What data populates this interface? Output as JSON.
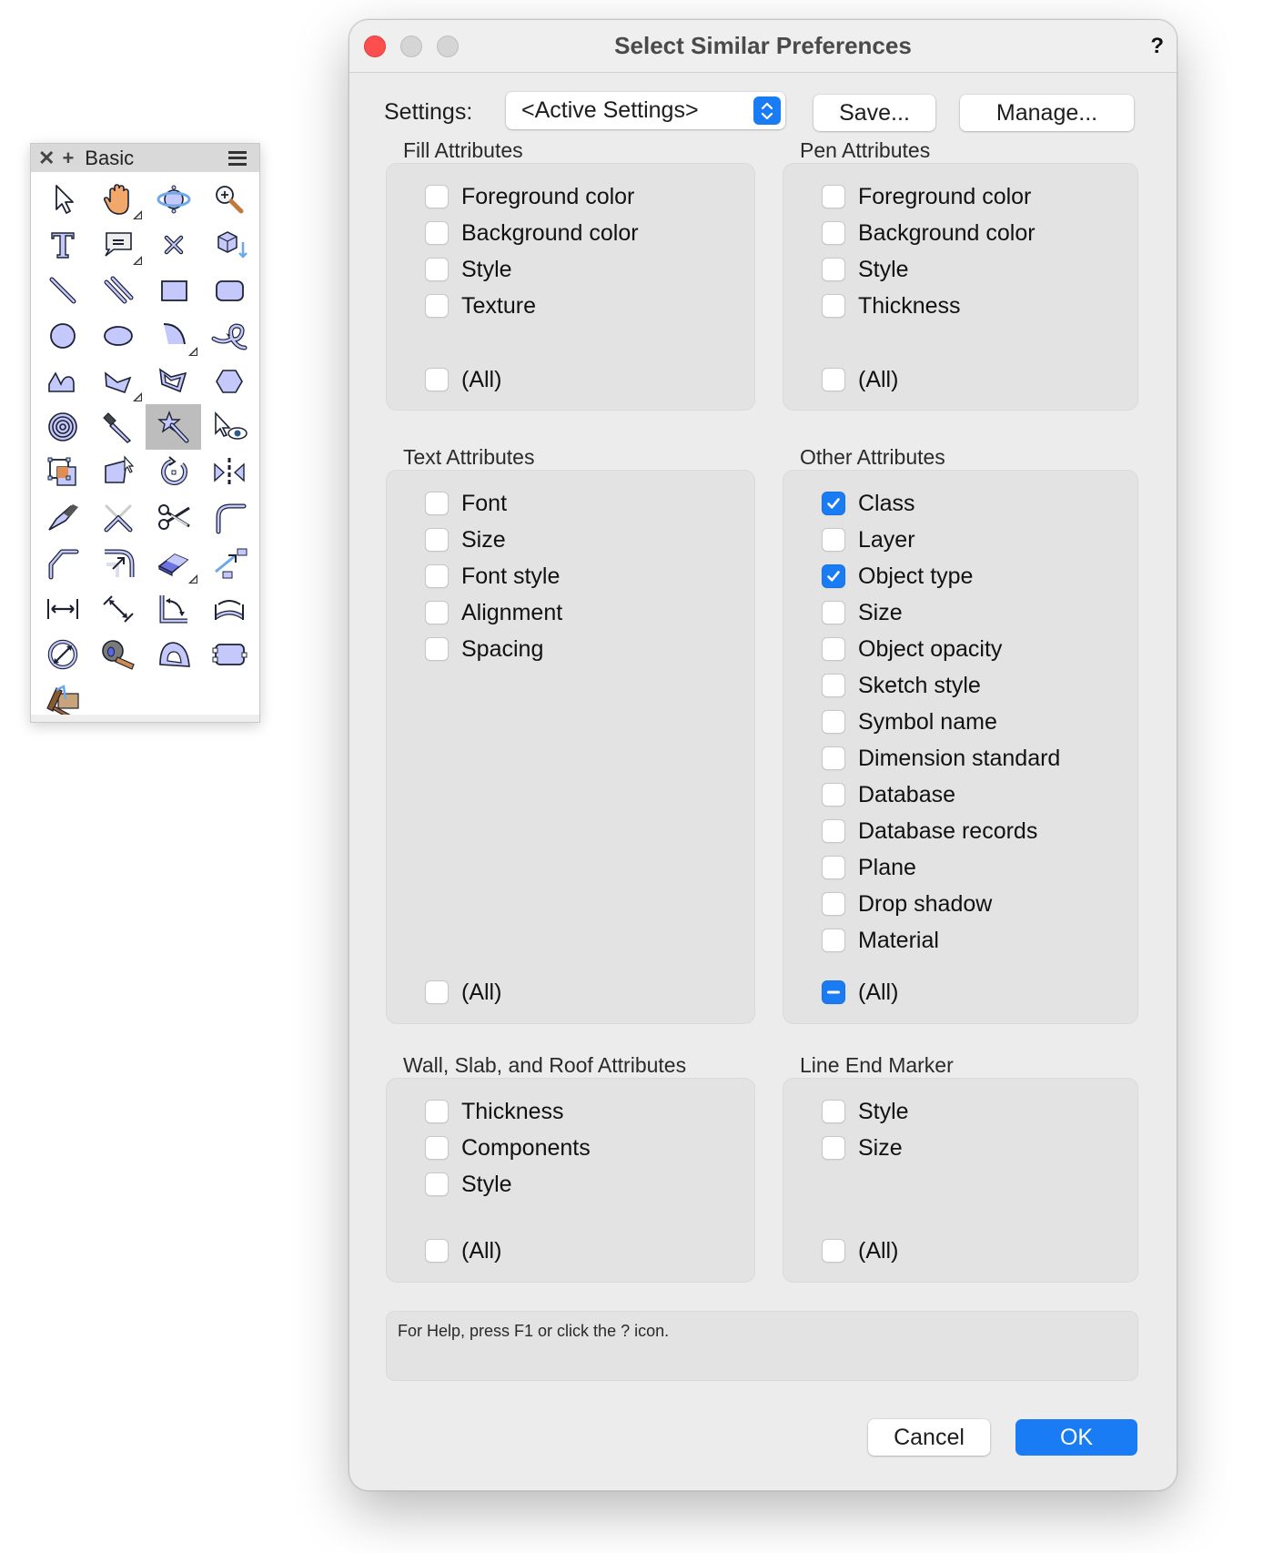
{
  "palette": {
    "title": "Basic",
    "close_glyph": "✕",
    "add_glyph": "+",
    "menu_icon": "hamburger-menu-icon",
    "tools": [
      {
        "name": "selection-tool",
        "has_submenu": false
      },
      {
        "name": "pan-tool",
        "has_submenu": true
      },
      {
        "name": "flyover-tool",
        "has_submenu": false
      },
      {
        "name": "zoom-tool",
        "has_submenu": false
      },
      {
        "name": "text-tool",
        "has_submenu": false
      },
      {
        "name": "callout-tool",
        "has_submenu": true
      },
      {
        "name": "locus-tool",
        "has_submenu": false
      },
      {
        "name": "3d-locus-tool",
        "has_submenu": false
      },
      {
        "name": "line-tool",
        "has_submenu": false
      },
      {
        "name": "double-line-tool",
        "has_submenu": false
      },
      {
        "name": "rectangle-tool",
        "has_submenu": false
      },
      {
        "name": "rounded-rectangle-tool",
        "has_submenu": false
      },
      {
        "name": "circle-tool",
        "has_submenu": false
      },
      {
        "name": "oval-tool",
        "has_submenu": false
      },
      {
        "name": "arc-tool",
        "has_submenu": true
      },
      {
        "name": "freehand-tool",
        "has_submenu": false
      },
      {
        "name": "polyline-tool",
        "has_submenu": false
      },
      {
        "name": "polygon-tool",
        "has_submenu": true
      },
      {
        "name": "double-line-polygon-tool",
        "has_submenu": false
      },
      {
        "name": "regular-polygon-tool",
        "has_submenu": false
      },
      {
        "name": "spiral-tool",
        "has_submenu": false
      },
      {
        "name": "eyedropper-tool",
        "has_submenu": false
      },
      {
        "name": "select-similar-tool",
        "has_submenu": false,
        "selected": true
      },
      {
        "name": "visibility-tool",
        "has_submenu": false
      },
      {
        "name": "reshape-tool",
        "has_submenu": false
      },
      {
        "name": "distort-tool",
        "has_submenu": false
      },
      {
        "name": "rotate-tool",
        "has_submenu": false
      },
      {
        "name": "mirror-tool",
        "has_submenu": false
      },
      {
        "name": "split-tool",
        "has_submenu": false
      },
      {
        "name": "trim-tool",
        "has_submenu": false
      },
      {
        "name": "scissors-tool",
        "has_submenu": false
      },
      {
        "name": "fillet-tool",
        "has_submenu": false
      },
      {
        "name": "chamfer-tool",
        "has_submenu": false
      },
      {
        "name": "offset-tool",
        "has_submenu": false
      },
      {
        "name": "eraser-tool",
        "has_submenu": true
      },
      {
        "name": "move-by-points-tool",
        "has_submenu": false
      },
      {
        "name": "dimension-tool",
        "has_submenu": false
      },
      {
        "name": "aligned-dimension-tool",
        "has_submenu": false
      },
      {
        "name": "angular-dimension-tool",
        "has_submenu": false
      },
      {
        "name": "arc-length-dimension-tool",
        "has_submenu": false
      },
      {
        "name": "radial-dimension-tool",
        "has_submenu": false
      },
      {
        "name": "tape-measure-tool",
        "has_submenu": false
      },
      {
        "name": "protractor-tool",
        "has_submenu": false
      },
      {
        "name": "data-tag-tool",
        "has_submenu": false
      },
      {
        "name": "attribute-mapping-tool",
        "has_submenu": false
      }
    ]
  },
  "dialog": {
    "title": "Select Similar Preferences",
    "help_label": "?",
    "settings": {
      "label": "Settings:",
      "selected": "<Active Settings>",
      "save_label": "Save...",
      "manage_label": "Manage..."
    },
    "groups": {
      "fill": {
        "title": "Fill Attributes",
        "items": [
          {
            "label": "Foreground color",
            "state": "unchecked"
          },
          {
            "label": "Background color",
            "state": "unchecked"
          },
          {
            "label": "Style",
            "state": "unchecked"
          },
          {
            "label": "Texture",
            "state": "unchecked"
          }
        ],
        "all": {
          "label": "(All)",
          "state": "unchecked"
        }
      },
      "pen": {
        "title": "Pen Attributes",
        "items": [
          {
            "label": "Foreground color",
            "state": "unchecked"
          },
          {
            "label": "Background color",
            "state": "unchecked"
          },
          {
            "label": "Style",
            "state": "unchecked"
          },
          {
            "label": "Thickness",
            "state": "unchecked"
          }
        ],
        "all": {
          "label": "(All)",
          "state": "unchecked"
        }
      },
      "text": {
        "title": "Text Attributes",
        "items": [
          {
            "label": "Font",
            "state": "unchecked"
          },
          {
            "label": "Size",
            "state": "unchecked"
          },
          {
            "label": "Font style",
            "state": "unchecked"
          },
          {
            "label": "Alignment",
            "state": "unchecked"
          },
          {
            "label": "Spacing",
            "state": "unchecked"
          }
        ],
        "all": {
          "label": "(All)",
          "state": "unchecked"
        }
      },
      "other": {
        "title": "Other Attributes",
        "items": [
          {
            "label": "Class",
            "state": "checked"
          },
          {
            "label": "Layer",
            "state": "unchecked"
          },
          {
            "label": "Object type",
            "state": "checked"
          },
          {
            "label": "Size",
            "state": "unchecked"
          },
          {
            "label": "Object opacity",
            "state": "unchecked"
          },
          {
            "label": "Sketch style",
            "state": "unchecked"
          },
          {
            "label": "Symbol name",
            "state": "unchecked"
          },
          {
            "label": "Dimension standard",
            "state": "unchecked"
          },
          {
            "label": "Database",
            "state": "unchecked"
          },
          {
            "label": "Database records",
            "state": "unchecked"
          },
          {
            "label": "Plane",
            "state": "unchecked"
          },
          {
            "label": "Drop shadow",
            "state": "unchecked"
          },
          {
            "label": "Material",
            "state": "unchecked"
          }
        ],
        "all": {
          "label": "(All)",
          "state": "mixed"
        }
      },
      "wall": {
        "title": "Wall, Slab, and Roof Attributes",
        "items": [
          {
            "label": "Thickness",
            "state": "unchecked"
          },
          {
            "label": "Components",
            "state": "unchecked"
          },
          {
            "label": "Style",
            "state": "unchecked"
          }
        ],
        "all": {
          "label": "(All)",
          "state": "unchecked"
        }
      },
      "lineend": {
        "title": "Line End Marker",
        "items": [
          {
            "label": "Style",
            "state": "unchecked"
          },
          {
            "label": "Size",
            "state": "unchecked"
          }
        ],
        "all": {
          "label": "(All)",
          "state": "unchecked"
        }
      }
    },
    "help_text": "For Help, press F1 or click the ? icon.",
    "cancel_label": "Cancel",
    "ok_label": "OK",
    "accent_color": "#1a7cf5",
    "close_color": "#fe4f4f"
  }
}
